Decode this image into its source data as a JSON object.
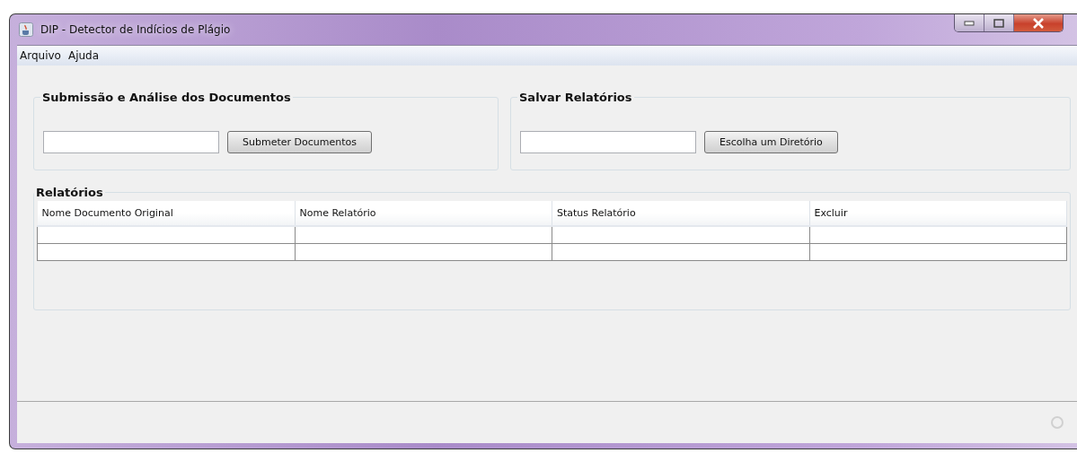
{
  "window": {
    "title": "DIP -  Detector de Indícios de Plágio"
  },
  "menu": [
    "Arquivo",
    "Ajuda"
  ],
  "panels": [
    {
      "title": "Submissão e Análise dos Documentos",
      "button": "Submeter Documentos"
    },
    {
      "title": "Salvar Relatórios",
      "button": "Escolha um Diretório"
    }
  ],
  "reports": {
    "title": "Relatórios",
    "columns": [
      "Nome Documento Original",
      "Nome Relatório",
      "Status Relatório",
      "Excluir"
    ]
  }
}
